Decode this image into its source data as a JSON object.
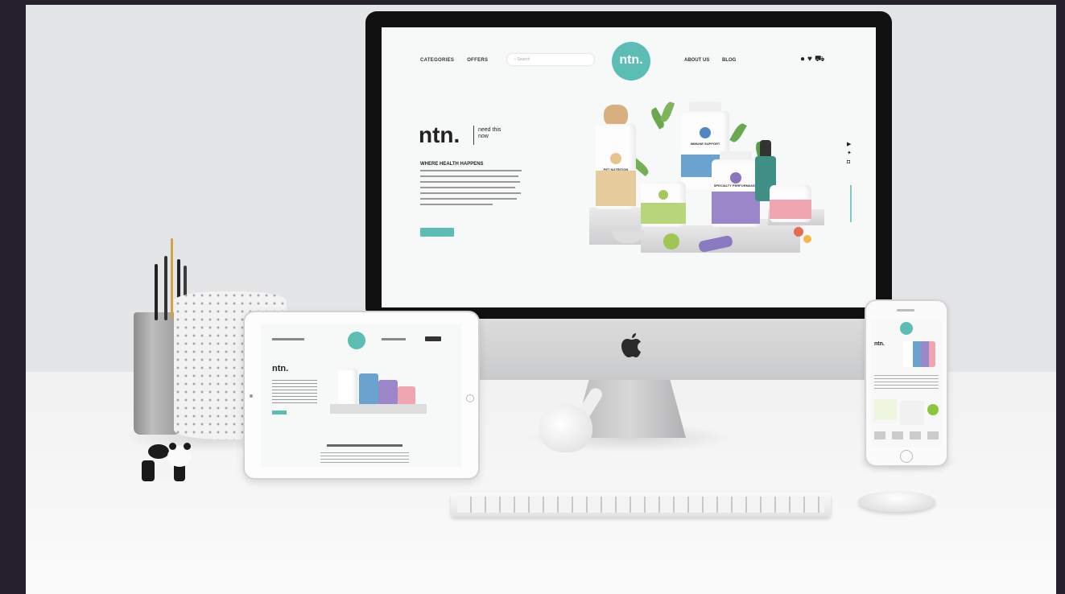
{
  "website": {
    "nav_left": [
      "CATEGORIES",
      "OFFERS"
    ],
    "search_placeholder": "Search",
    "logo": "ntn.",
    "nav_right": [
      "ABOUT US",
      "BLOG"
    ],
    "nav_icons": [
      "user-icon",
      "heart-icon",
      "cart-icon"
    ],
    "brand": "ntn.",
    "tagline": "need this now",
    "hero_heading": "WHERE HEALTH HAPPENS",
    "social_icons": [
      "youtube-icon",
      "twitter-icon",
      "instagram-icon"
    ],
    "product_labels": [
      "PET NUTRITION",
      "IMMUNE SUPPORT",
      "SPECIALTY PERFORMANCE"
    ]
  },
  "colors": {
    "brand_teal": "#5bbdb3",
    "backdrop": "#24202e",
    "wall": "#e4e5e7",
    "desk": "#f7f7f7"
  }
}
